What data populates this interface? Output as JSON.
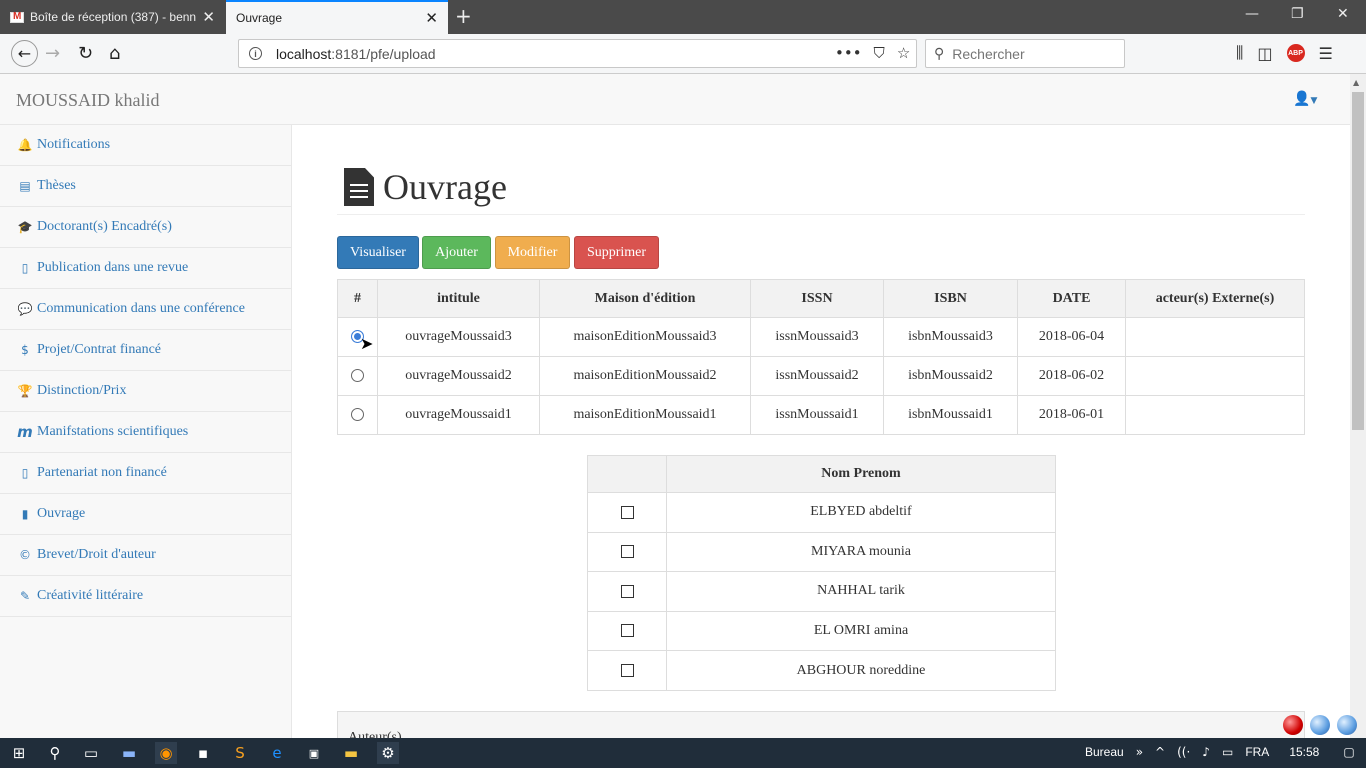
{
  "browser": {
    "tabs": [
      {
        "title": "Boîte de réception (387) - benn",
        "close": "✕"
      },
      {
        "title": "Ouvrage",
        "close": "✕"
      }
    ],
    "new_tab": "+",
    "url_host": "localhost",
    "url_rest": ":8181/pfe/upload",
    "search_placeholder": "Rechercher",
    "adblock": "ABP"
  },
  "app": {
    "brand": "MOUSSAID khalid",
    "sidebar": [
      {
        "icon": "🔔",
        "label": "Notifications"
      },
      {
        "icon": "▤",
        "label": "Thèses"
      },
      {
        "icon": "🎓",
        "label": "Doctorant(s) Encadré(s)"
      },
      {
        "icon": "▯",
        "label": "Publication dans une revue"
      },
      {
        "icon": "💬",
        "label": "Communication dans une conférence"
      },
      {
        "icon": "$",
        "label": "Projet/Contrat financé"
      },
      {
        "icon": "🏆",
        "label": "Distinction/Prix"
      },
      {
        "icon": "m",
        "label": "Manifstations scientifiques"
      },
      {
        "icon": "▯",
        "label": "Partenariat non financé"
      },
      {
        "icon": "▮",
        "label": "Ouvrage"
      },
      {
        "icon": "©",
        "label": "Brevet/Droit d'auteur"
      },
      {
        "icon": "✎",
        "label": "Créativité littéraire"
      }
    ],
    "page_title": "Ouvrage",
    "buttons": {
      "view": "Visualiser",
      "add": "Ajouter",
      "edit": "Modifier",
      "delete": "Supprimer"
    },
    "table": {
      "headers": [
        "#",
        "intitule",
        "Maison d'édition",
        "ISSN",
        "ISBN",
        "DATE",
        "acteur(s) Externe(s)"
      ],
      "rows": [
        {
          "selected": true,
          "intitule": "ouvrageMoussaid3",
          "maison": "maisonEditionMoussaid3",
          "issn": "issnMoussaid3",
          "isbn": "isbnMoussaid3",
          "date": "2018-06-04",
          "acteurs": ""
        },
        {
          "selected": false,
          "intitule": "ouvrageMoussaid2",
          "maison": "maisonEditionMoussaid2",
          "issn": "issnMoussaid2",
          "isbn": "isbnMoussaid2",
          "date": "2018-06-02",
          "acteurs": ""
        },
        {
          "selected": false,
          "intitule": "ouvrageMoussaid1",
          "maison": "maisonEditionMoussaid1",
          "issn": "issnMoussaid1",
          "isbn": "isbnMoussaid1",
          "date": "2018-06-01",
          "acteurs": ""
        }
      ]
    },
    "members": {
      "header": "Nom Prenom",
      "rows": [
        "ELBYED abdeltif",
        "MIYARA mounia",
        "NAHHAL tarik",
        "EL OMRI amina",
        "ABGHOUR noreddine"
      ]
    },
    "panel2_label": "Auteur(s)"
  },
  "taskbar": {
    "bureau": "Bureau",
    "lang": "FRA",
    "time": "15:58"
  },
  "colors": {
    "primary": "#337ab7",
    "success": "#5cb85c",
    "warning": "#f0ad4e",
    "danger": "#d9534f"
  }
}
